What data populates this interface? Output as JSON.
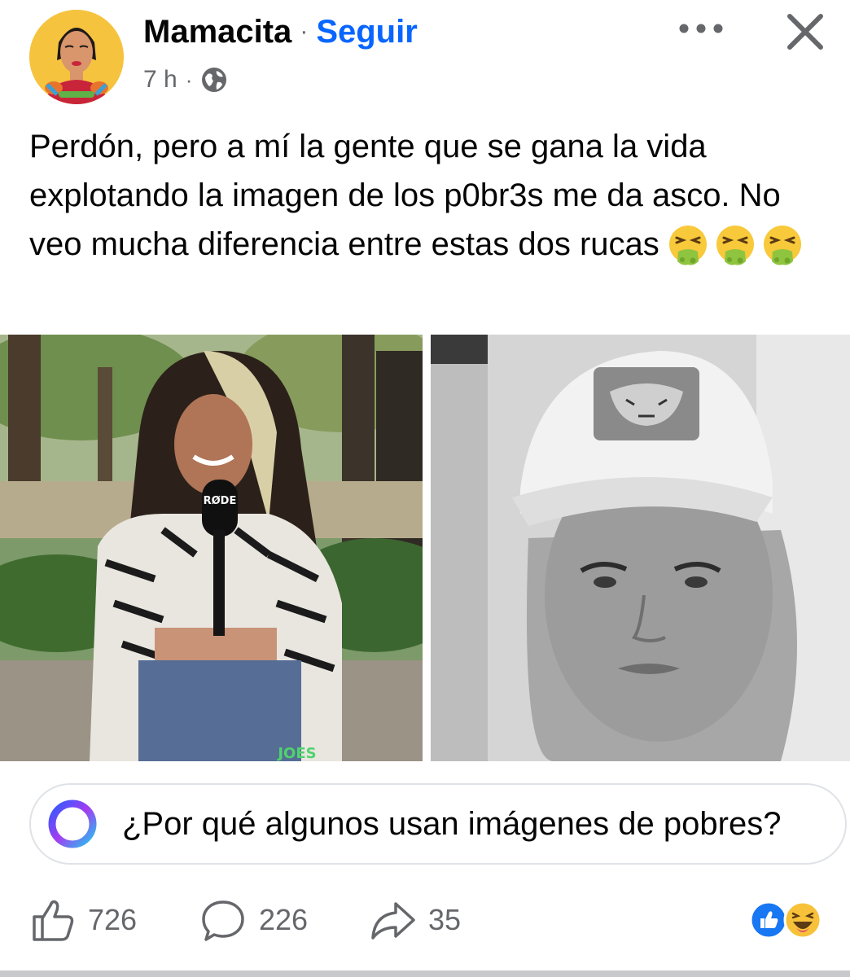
{
  "post": {
    "author": "Mamacita",
    "separator": "·",
    "follow_label": "Seguir",
    "time": "7 h",
    "audience_icon": "globe-icon",
    "text": "Perdón, pero a mí la gente que se gana la vida explotando la imagen de los p0br3s me da asco. No veo mucha diferencia entre estas dos rucas",
    "emojis": [
      "face-vomiting",
      "face-vomiting",
      "face-vomiting"
    ]
  },
  "photos": [
    {
      "kind": "color-photo",
      "mic_text": "RØDE",
      "jeans_text": "JOES"
    },
    {
      "kind": "grayscale-photo"
    }
  ],
  "meta_ai": {
    "icon": "meta-ai-ring-icon",
    "prompt": "¿Por qué algunos usan imágenes de pobres?"
  },
  "actions": {
    "likes": "726",
    "comments": "226",
    "shares": "35",
    "reaction_icons": [
      "like-reaction",
      "haha-reaction"
    ]
  },
  "colors": {
    "follow_blue": "#0866ff",
    "secondary_text": "#65676b",
    "like_blue": "#1877f2",
    "haha_yellow": "#f7c23a"
  }
}
